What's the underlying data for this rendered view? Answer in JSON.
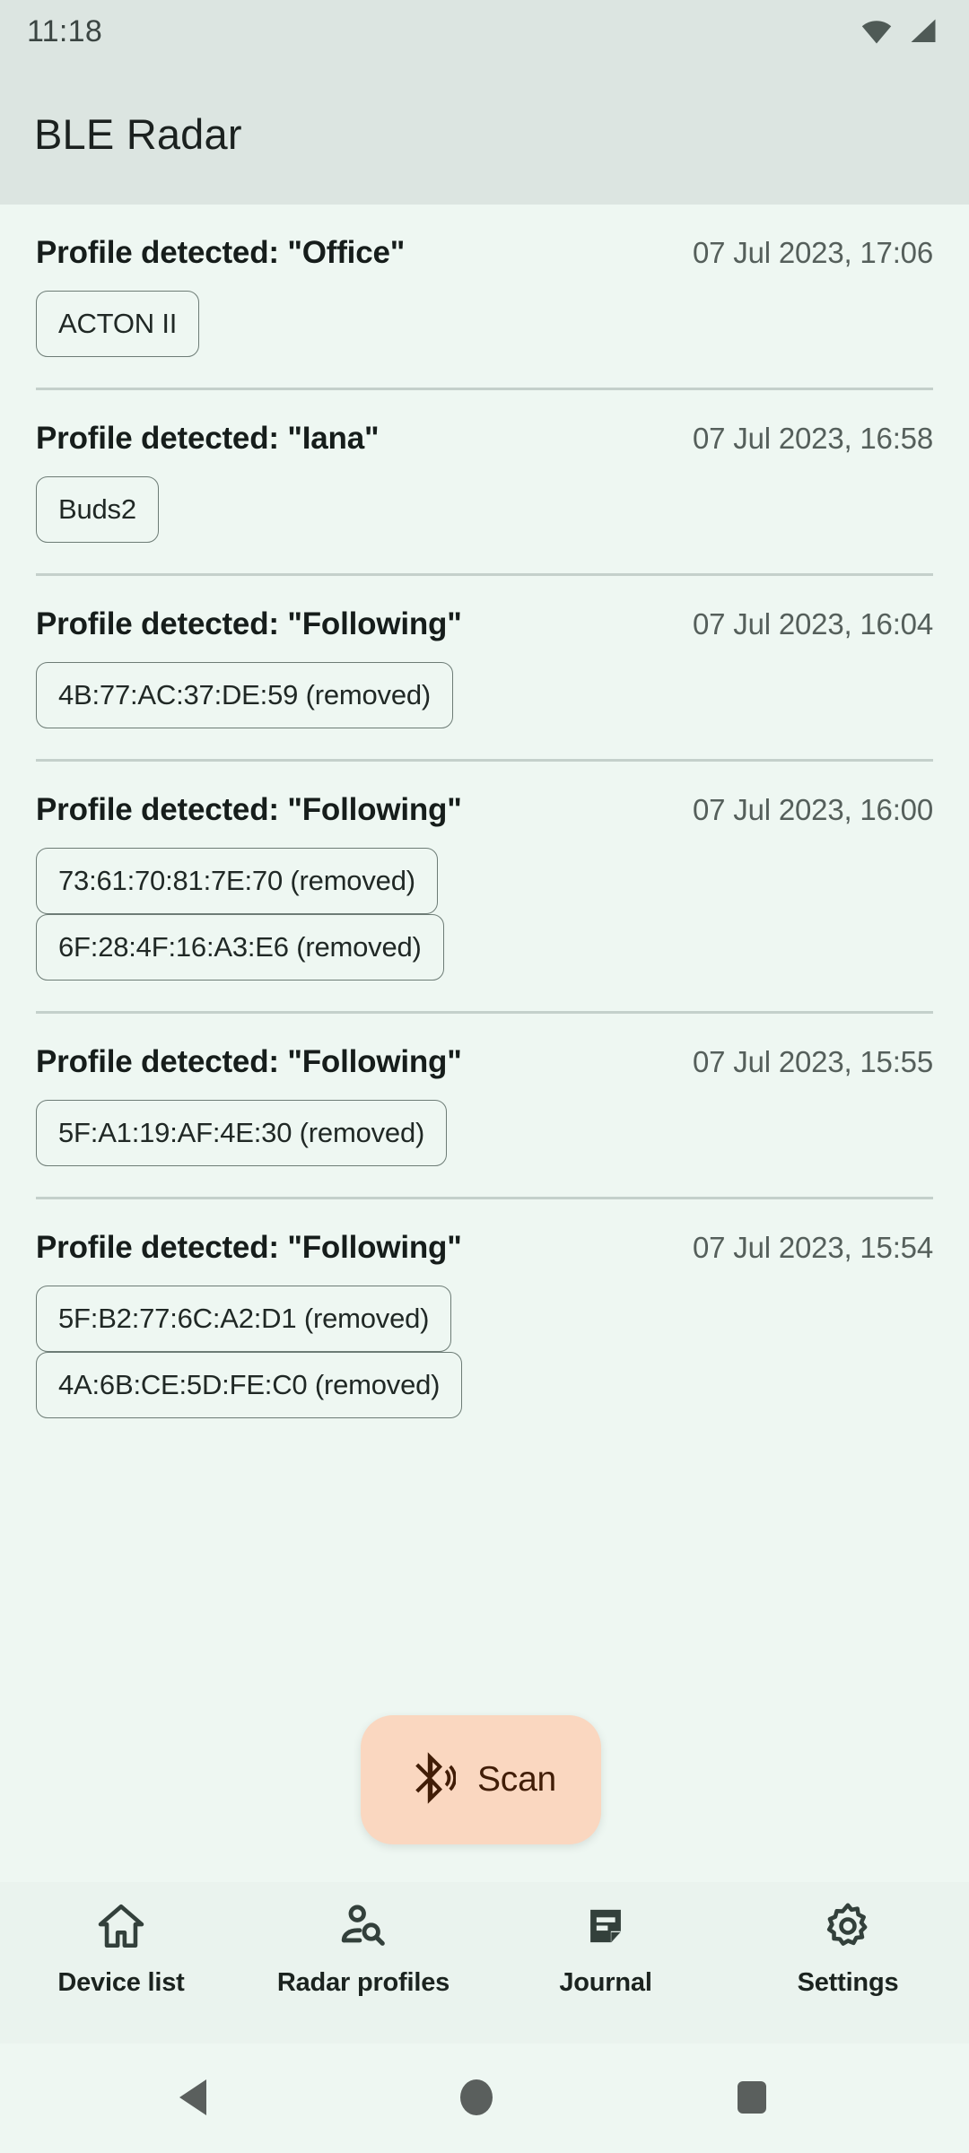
{
  "status_bar": {
    "clock": "11:18",
    "icons": [
      "wifi-icon",
      "signal-icon"
    ]
  },
  "app_bar": {
    "title": "BLE Radar"
  },
  "journal": {
    "entries": [
      {
        "title": "Profile detected: \"Office\"",
        "timestamp": "07 Jul 2023, 17:06",
        "devices": [
          "ACTON II"
        ]
      },
      {
        "title": "Profile detected: \"Iana\"",
        "timestamp": "07 Jul 2023, 16:58",
        "devices": [
          "Buds2"
        ]
      },
      {
        "title": "Profile detected: \"Following\"",
        "timestamp": "07 Jul 2023, 16:04",
        "devices": [
          "4B:77:AC:37:DE:59 (removed)"
        ]
      },
      {
        "title": "Profile detected: \"Following\"",
        "timestamp": "07 Jul 2023, 16:00",
        "devices": [
          "73:61:70:81:7E:70 (removed)",
          "6F:28:4F:16:A3:E6 (removed)"
        ]
      },
      {
        "title": "Profile detected: \"Following\"",
        "timestamp": "07 Jul 2023, 15:55",
        "devices": [
          "5F:A1:19:AF:4E:30 (removed)"
        ]
      },
      {
        "title": "Profile detected: \"Following\"",
        "timestamp": "07 Jul 2023, 15:54",
        "devices": [
          "5F:B2:77:6C:A2:D1 (removed)",
          "4A:6B:CE:5D:FE:C0 (removed)"
        ]
      }
    ]
  },
  "fab": {
    "label": "Scan",
    "icon": "bluetooth-searching-icon",
    "background": "#fad7c0",
    "foreground": "#411d07"
  },
  "bottom_nav": {
    "items": [
      {
        "label": "Device list",
        "icon": "home-icon",
        "active": false
      },
      {
        "label": "Radar profiles",
        "icon": "person-search-icon",
        "active": false
      },
      {
        "label": "Journal",
        "icon": "article-icon",
        "active": true
      },
      {
        "label": "Settings",
        "icon": "gear-icon",
        "active": false
      }
    ]
  },
  "system_nav": {
    "buttons": [
      "back-triangle-icon",
      "home-circle-icon",
      "recents-square-icon"
    ]
  },
  "colors": {
    "app_bar": "#dce5e1",
    "surface": "#eef7f2",
    "divider": "#c4d0cb",
    "chip_border": "#6d7c76",
    "on_surface": "#161d1b",
    "on_surface_variant": "#555f5b"
  }
}
